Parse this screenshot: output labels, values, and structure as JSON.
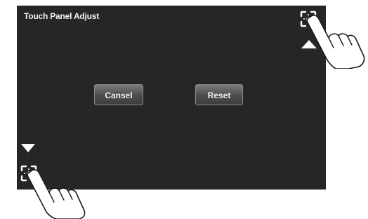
{
  "screen": {
    "title": "Touch Panel Adjust",
    "cancel_label": "Cansel",
    "reset_label": "Reset",
    "background_color": "#262626",
    "text_color": "#f2f2f2"
  },
  "icons": {
    "top_target": "crosshair-target-icon",
    "bottom_target": "crosshair-target-icon",
    "up_marker": "triangle-up-icon",
    "down_marker": "triangle-down-icon",
    "hand": "pointing-hand-icon"
  }
}
